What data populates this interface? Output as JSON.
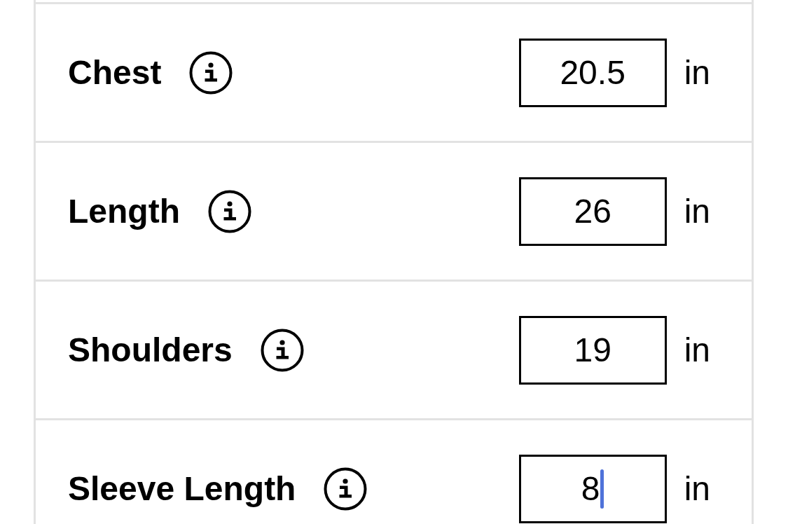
{
  "measurements": [
    {
      "label": "Chest",
      "value": "20.5",
      "unit": "in",
      "focused": false
    },
    {
      "label": "Length",
      "value": "26",
      "unit": "in",
      "focused": false
    },
    {
      "label": "Shoulders",
      "value": "19",
      "unit": "in",
      "focused": false
    },
    {
      "label": "Sleeve Length",
      "value": "8",
      "unit": "in",
      "focused": true
    }
  ]
}
